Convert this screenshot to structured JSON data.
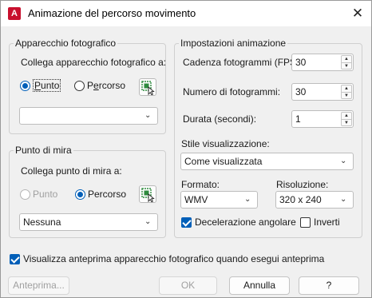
{
  "window": {
    "title": "Animazione del percorso movimento",
    "app_icon_letter": "A",
    "close_glyph": "✕"
  },
  "camera": {
    "group_title": "Apparecchio fotografico",
    "link_label": "Collega apparecchio fotografico a:",
    "radio_point": "Punto",
    "radio_path": "Percorso",
    "point_selected": true,
    "dropdown_value": ""
  },
  "target": {
    "group_title": "Punto di mira",
    "link_label": "Collega punto di mira a:",
    "radio_point": "Punto",
    "radio_path": "Percorso",
    "point_enabled": false,
    "path_selected": true,
    "dropdown_value": "Nessuna"
  },
  "animation": {
    "group_title": "Impostazioni animazione",
    "fps_label": "Cadenza fotogrammi (FPS):",
    "fps_value": "30",
    "frames_label": "Numero di fotogrammi:",
    "frames_value": "30",
    "duration_label": "Durata (secondi):",
    "duration_value": "1",
    "style_label": "Stile visualizzazione:",
    "style_value": "Come visualizzata",
    "format_label": "Formato:",
    "format_value": "WMV",
    "resolution_label": "Risoluzione:",
    "resolution_value": "320 x 240",
    "ease_label": "Decelerazione angolare",
    "ease_checked": true,
    "reverse_label": "Inverti",
    "reverse_checked": false
  },
  "preview_checkbox": {
    "label": "Visualizza anteprima apparecchio fotografico quando esegui anteprima",
    "checked": true
  },
  "buttons": {
    "preview": "Anteprima...",
    "ok": "OK",
    "cancel": "Annulla",
    "help": "?"
  },
  "colors": {
    "accent": "#005fb8",
    "app_icon": "#c8102e",
    "pick_icon": "#2e8b3e"
  },
  "icons": {
    "pick": "select-object-icon",
    "dropdown": "chevron-down-icon",
    "spin": "spinner-arrows-icon"
  }
}
